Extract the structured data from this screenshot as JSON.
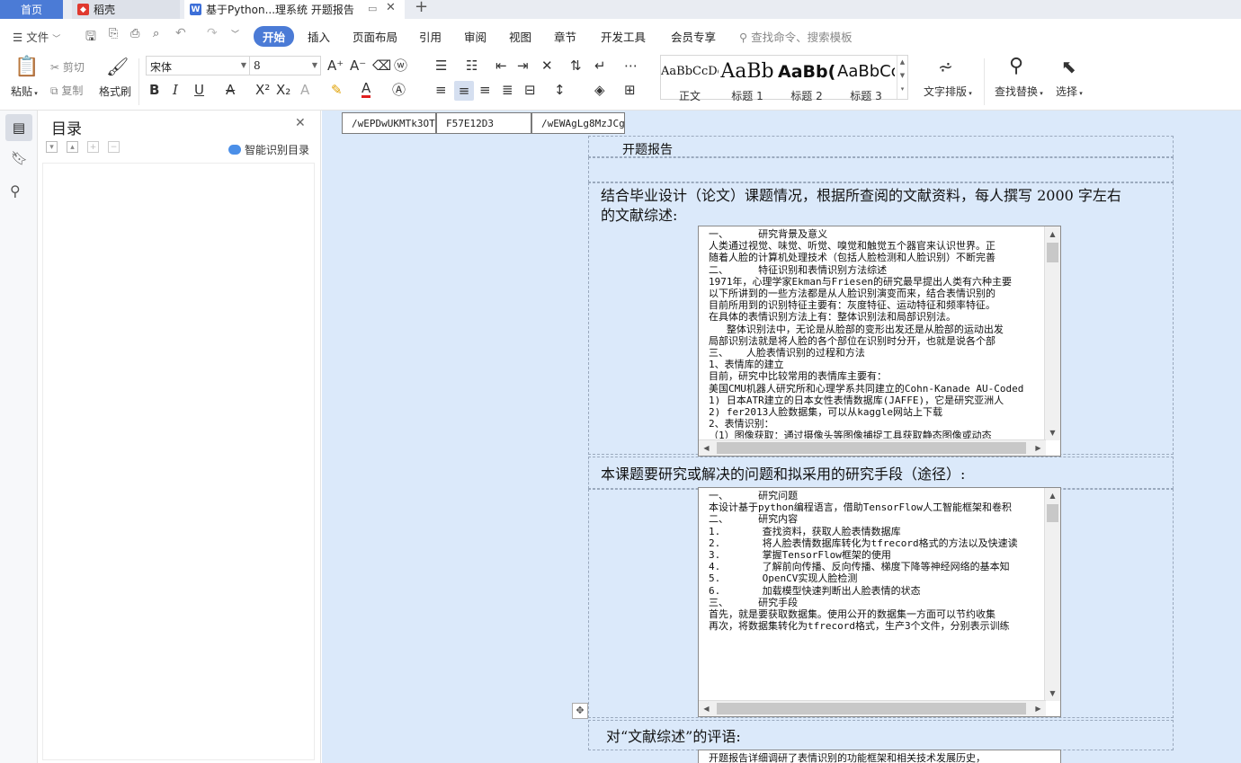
{
  "tabs": {
    "home": "首页",
    "daoke": "稻壳",
    "doc": "基于Python...理系统 开题报告",
    "add": "+"
  },
  "menu": {
    "file": "文件",
    "items": [
      "开始",
      "插入",
      "页面布局",
      "引用",
      "审阅",
      "视图",
      "章节",
      "开发工具",
      "会员专享"
    ],
    "search": "查找命令、搜索模板"
  },
  "ribbon": {
    "paste": "粘贴",
    "cut": "剪切",
    "copy": "复制",
    "format_painter": "格式刷",
    "font_name": "宋体",
    "font_size": "8",
    "styles": [
      {
        "preview": "AaBbCcDd",
        "label": "正文"
      },
      {
        "preview": "AaBb",
        "label": "标题 1"
      },
      {
        "preview": "AaBb(",
        "label": "标题 2"
      },
      {
        "preview": "AaBbCc",
        "label": "标题 3"
      }
    ],
    "text_layout": "文字排版",
    "find_replace": "查找替换",
    "select": "选择"
  },
  "toc": {
    "title": "目录",
    "smart": "智能识别目录"
  },
  "doc": {
    "fields": [
      "/wEPDwUKMTk3OTk",
      "F57E12D3",
      "/wEWAgLg8MzJCg"
    ],
    "title": "开题报告",
    "q1": "结合毕业设计（论文）课题情况，根据所查阅的文献资料，每人撰写 2000 字左右",
    "q1b": "的文献综述:",
    "box1": "一、     研究背景及意义\n人类通过视觉、味觉、听觉、嗅觉和触觉五个器官来认识世界。正\n随着人脸的计算机处理技术（包括人脸检测和人脸识别）不断完善\n二、     特征识别和表情识别方法综述\n1971年，心理学家Ekman与Friesen的研究最早提出人类有六种主要\n以下所讲到的一些方法都是从人脸识别演变而来，结合表情识别的\n目前所用到的识别特征主要有：灰度特征、运动特征和频率特征。\n在具体的表情识别方法上有：整体识别法和局部识别法。\n   整体识别法中，无论是从脸部的变形出发还是从脸部的运动出发\n局部识别法就是将人脸的各个部位在识别时分开，也就是说各个部\n三、   人脸表情识别的过程和方法\n1、表情库的建立\n目前，研究中比较常用的表情库主要有：\n美国CMU机器人研究所和心理学系共同建立的Cohn-Kanade AU-Coded\n1) 日本ATR建立的日本女性表情数据库(JAFFE)，它是研究亚洲人\n2) fer2013人脸数据集，可以从kaggle网站上下载\n2、表情识别：\n（1）图像获取：通过摄像头等图像捕捉工具获取静态图像或动态",
    "q2": "本课题要研究或解决的问题和拟采用的研究手段（途径）:",
    "box2": "一、     研究问题\n本设计基于python编程语言，借助TensorFlow人工智能框架和卷积\n二、     研究内容\n1.       查找资料，获取人脸表情数据库\n2.       将人脸表情数据库转化为tfrecord格式的方法以及快速读\n3.       掌握TensorFlow框架的使用\n4.       了解前向传播、反向传播、梯度下降等神经网络的基本知\n5.       OpenCV实现人脸检测\n6.       加载模型快速判断出人脸表情的状态\n三、     研究手段\n首先，就是要获取数据集。使用公开的数据集一方面可以节约收集\n再次，将数据集转化为tfrecord格式，生产3个文件，分别表示训练",
    "q3": "对“文献综述”的评语:",
    "box3": "开题报告详细调研了表情识别的功能框架和相关技术发展历史，"
  }
}
